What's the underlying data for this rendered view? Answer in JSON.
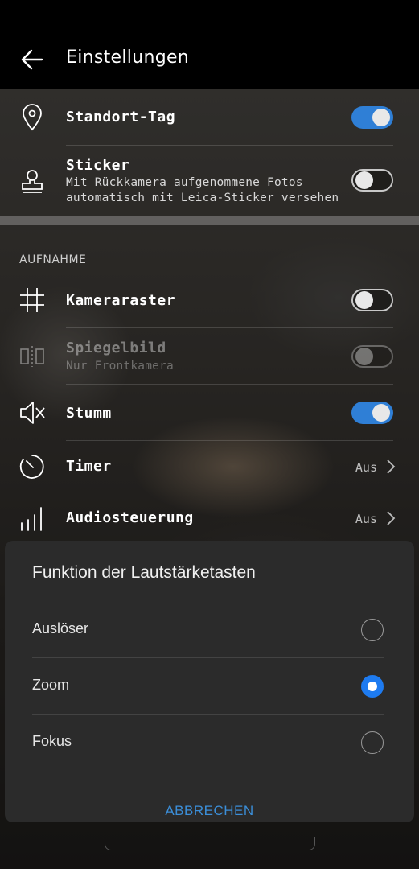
{
  "header": {
    "title": "Einstellungen"
  },
  "rows": {
    "standort": {
      "label": "Standort-Tag",
      "toggle": "on"
    },
    "sticker": {
      "label": "Sticker",
      "sub1": "Mit Rückkamera aufgenommene Fotos",
      "sub2": "automatisch mit Leica-Sticker versehen",
      "toggle": "off"
    },
    "section": "AUFNAHME",
    "kameraraster": {
      "label": "Kameraraster",
      "toggle": "off"
    },
    "spiegelbild": {
      "label": "Spiegelbild",
      "sub": "Nur Frontkamera",
      "toggle": "off",
      "enabled": false
    },
    "stumm": {
      "label": "Stumm",
      "toggle": "on"
    },
    "timer": {
      "label": "Timer",
      "value": "Aus"
    },
    "audio": {
      "label": "Audiosteuerung",
      "value": "Aus"
    }
  },
  "dialog": {
    "title": "Funktion der Lautstärketasten",
    "options": [
      {
        "label": "Auslöser",
        "selected": false
      },
      {
        "label": "Zoom",
        "selected": true
      },
      {
        "label": "Fokus",
        "selected": false
      }
    ],
    "cancel": "ABBRECHEN"
  },
  "colors": {
    "accent": "#2f7fd6",
    "radio_selected": "#1e7bf0",
    "cancel_text": "#3b8ed8"
  }
}
